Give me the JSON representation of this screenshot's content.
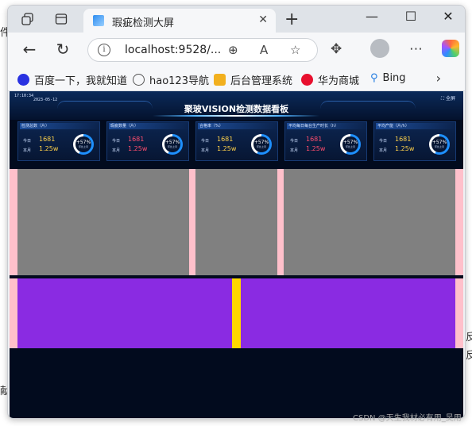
{
  "background_text": {
    "left_char": "件",
    "right_char_1": "反",
    "right_char_2": "反",
    "left_char_2": "献"
  },
  "tab": {
    "title": "瑕疵检测大屏",
    "close": "✕"
  },
  "window_controls": {
    "minimize": "—",
    "maximize": "☐",
    "close": "✕"
  },
  "address": {
    "url": "localhost:9528/..."
  },
  "bookmarks": [
    {
      "label": "百度一下，我就知道",
      "icon": "baidu-icon",
      "color": "#2932e1"
    },
    {
      "label": "hao123导航",
      "icon": "globe-icon",
      "color": "#555555"
    },
    {
      "label": "后台管理系统",
      "icon": "folder-icon",
      "color": "#f2b01e"
    },
    {
      "label": "华为商城",
      "icon": "huawei-icon",
      "color": "#e8102e"
    },
    {
      "label": "Bing",
      "icon": "bing-search-icon",
      "color": "#1f7ae0"
    }
  ],
  "dashboard": {
    "clock": "17:10:34",
    "date": "2023-05-12",
    "title": "聚玻VISION检测数据看板",
    "fullscreen": "⛶ 全屏",
    "cards": [
      {
        "title": "检测总数（片）",
        "today_label": "今日",
        "today": "1681",
        "month_label": "本月",
        "month": "1.25w",
        "pct": "+57%",
        "ring_label": "环比上月",
        "today_color": "#ffd24a"
      },
      {
        "title": "瑕疵数量（片）",
        "today_label": "今日",
        "today": "1681",
        "month_label": "本月",
        "month": "1.25w",
        "pct": "+57%",
        "ring_label": "环比上月",
        "today_color": "#ff4d6d"
      },
      {
        "title": "合格率（%）",
        "today_label": "今日",
        "today": "1681",
        "month_label": "本月",
        "month": "1.25w",
        "pct": "+57%",
        "ring_label": "环比上月",
        "today_color": "#ffd24a"
      },
      {
        "title": "平均每日每台生产时长（h）",
        "today_label": "今日",
        "today": "1681",
        "month_label": "本月",
        "month": "1.25w",
        "pct": "+57%",
        "ring_label": "环比上月",
        "today_color": "#ff4d6d"
      },
      {
        "title": "平均产能（片/h）",
        "today_label": "今日",
        "today": "1681",
        "month_label": "本月",
        "month": "1.25w",
        "pct": "+57%",
        "ring_label": "环比上月",
        "today_color": "#ffd24a"
      }
    ]
  },
  "watermark": "CSDN @天生我材必有用_吴用"
}
